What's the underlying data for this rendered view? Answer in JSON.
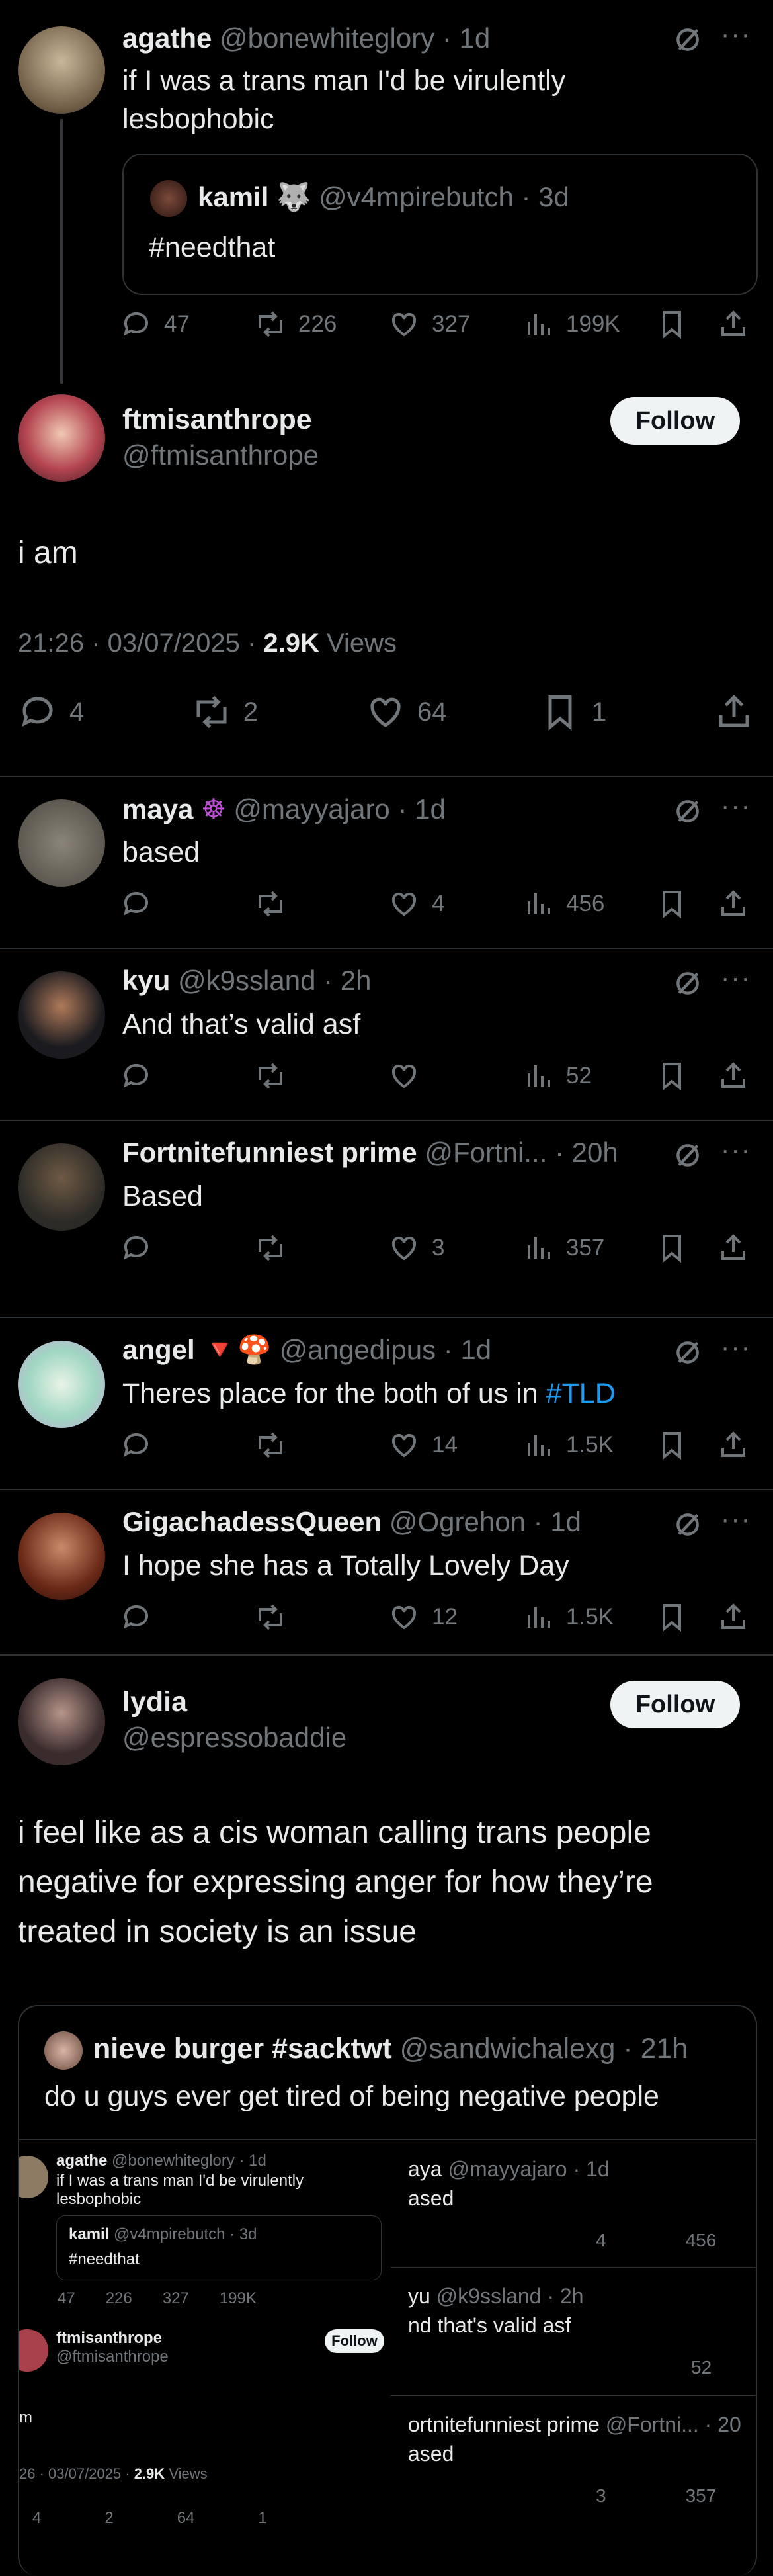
{
  "thread": {
    "agathe": {
      "name": "agathe",
      "handle": "@bonewhiteglory",
      "time": "· 1d",
      "text_line1": "if I was a trans man I'd be virulently",
      "text_line2": "lesbophobic",
      "quote": {
        "name": "kamil",
        "emoji": "🐺",
        "handle": "@v4mpirebutch",
        "time": "· 3d",
        "text": "#needthat"
      },
      "stats": {
        "replies": "47",
        "reposts": "226",
        "likes": "327",
        "views": "199K"
      }
    },
    "main": {
      "name": "ftmisanthrope",
      "handle": "@ftmisanthrope",
      "follow": "Follow",
      "text": "i am",
      "timestamp": "21:26 · 03/07/2025 ·",
      "views_count": "2.9K",
      "views_label": "Views",
      "stats": {
        "replies": "4",
        "reposts": "2",
        "likes": "64",
        "bookmarks": "1"
      }
    }
  },
  "replies": [
    {
      "name": "maya",
      "badge": "☸",
      "handle": "@mayyajaro",
      "time": "· 1d",
      "text": "based",
      "likes": "4",
      "views": "456"
    },
    {
      "name": "kyu",
      "handle": "@k9ssland",
      "time": "· 2h",
      "text": "And that’s valid asf",
      "likes": "",
      "views": "52"
    },
    {
      "name": "Fortnitefunniest prime",
      "handle": "@Fortni...",
      "time": "· 20h",
      "text": "Based",
      "likes": "3",
      "views": "357"
    },
    {
      "name": "angel",
      "badge": "🔻🍄",
      "handle": "@angedipus",
      "time": "· 1d",
      "text": "Theres place for the both of us in ",
      "link": "#TLD",
      "likes": "14",
      "views": "1.5K"
    },
    {
      "name": "GigachadessQueen",
      "handle": "@Ogrehon",
      "time": "· 1d",
      "text": "I hope she has a Totally Lovely Day",
      "likes": "12",
      "views": "1.5K"
    }
  ],
  "lydia": {
    "name": "lydia",
    "handle": "@espressobaddie",
    "follow": "Follow",
    "text_lines": [
      "i feel like as a cis woman calling trans people",
      "negative for expressing anger for how they’re",
      "treated in society is an issue"
    ],
    "quote": {
      "name": "nieve burger #sacktwt",
      "handle": "@sandwichalexg",
      "time": "· 21h",
      "text": "do u guys ever get tired of being negative people",
      "shot_left": {
        "name": "agathe",
        "handle": "@bonewhiteglory · 1d",
        "line1": "if I was a trans man I'd be virulently",
        "line2": "lesbophobic",
        "qname": "kamil",
        "qhandle": "@v4mpirebutch · 3d",
        "qtext": "#needthat",
        "s1": "47",
        "s2": "226",
        "s3": "327",
        "s4": "199K",
        "mname": "ftmisanthrope",
        "mhandle": "@ftmisanthrope",
        "mfollow": "Follow",
        "mtext": "m",
        "mtime": "26 · 03/07/2025 ·",
        "mviews": "2.9K",
        "mviews_label": "Views",
        "m1": "4",
        "m2": "2",
        "m3": "64",
        "m4": "1"
      },
      "shot_right": {
        "r1name": "aya",
        "r1handle": "@mayyajaro · 1d",
        "r1text": "ased",
        "r1likes": "4",
        "r1views": "456",
        "r2name": "yu",
        "r2handle": "@k9ssland · 2h",
        "r2text": "nd that's valid asf",
        "r2views": "52",
        "r3name": "ortnitefunniest prime",
        "r3handle": "@Fortni... · 20",
        "r3text": "ased",
        "r3likes": "3",
        "r3views": "357"
      }
    }
  }
}
